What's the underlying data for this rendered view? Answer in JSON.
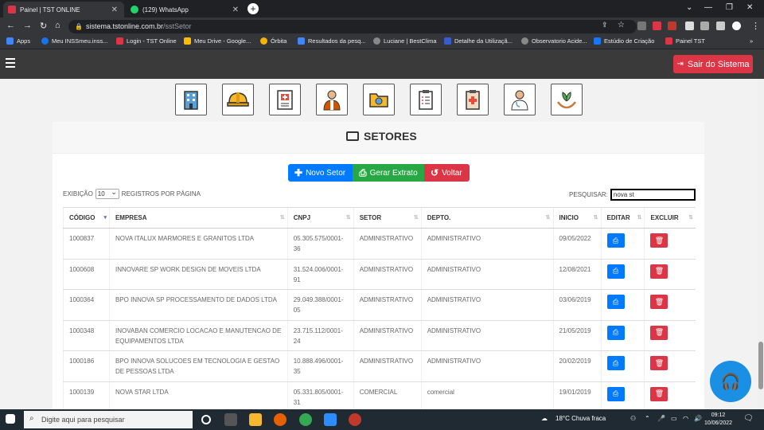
{
  "browser": {
    "tabs": [
      {
        "title": "Painel | TST ONLINE",
        "icon": "tst-favicon",
        "active": true
      },
      {
        "title": "(129) WhatsApp",
        "icon": "whatsapp-favicon",
        "active": false
      }
    ],
    "url_domain": "sistema.tstonline.com.br",
    "url_path": "/sstSetor",
    "bookmarks": [
      "Apps",
      "Meu INSSmeu.inss...",
      "Login - TST Online",
      "Meu Drive - Google...",
      "Órbita",
      "Resultados da pesq...",
      "Luciane | BestClima",
      "Detalhe da Utilizaçã...",
      "Observatorio Acide...",
      "Estúdio de Criação",
      "Painel TST"
    ],
    "bookmarks_more": "»"
  },
  "header": {
    "logout_label": "Sair do Sistema"
  },
  "modules": [
    "building-icon",
    "helmet-icon",
    "medical-record-icon",
    "worker-icon",
    "folder-icon",
    "clipboard-list-icon",
    "medical-clipboard-icon",
    "doctor-icon",
    "plant-hands-icon"
  ],
  "page": {
    "title": "SETORES",
    "btn_new": "Novo Setor",
    "btn_export": "Gerar Extrato",
    "btn_back": "Voltar",
    "show_label": "EXIBIÇÃO",
    "show_value": "10",
    "per_page_label": "REGISTROS POR PÁGINA",
    "search_label": "PESQUISAR:",
    "search_value": "nova st"
  },
  "table": {
    "headers": [
      "CÓDIGO",
      "EMPRESA",
      "CNPJ",
      "SETOR",
      "DEPTO.",
      "INICIO",
      "EDITAR",
      "EXCLUIR"
    ],
    "rows": [
      {
        "codigo": "1000837",
        "empresa": "NOVA ITALUX MARMORES E GRANITOS LTDA",
        "cnpj": "05.305.575/0001-36",
        "setor": "ADMINISTRATIVO",
        "depto": "ADMINISTRATIVO",
        "inicio": "09/05/2022"
      },
      {
        "codigo": "1000608",
        "empresa": "INNOVARE SP WORK DESIGN DE MOVEIS LTDA",
        "cnpj": "31.524.006/0001-91",
        "setor": "ADMINISTRATIVO",
        "depto": "ADMINISTRATIVO",
        "inicio": "12/08/2021"
      },
      {
        "codigo": "1000364",
        "empresa": "BPO INNOVA SP PROCESSAMENTO DE DADOS LTDA",
        "cnpj": "29.049.388/0001-05",
        "setor": "ADMINISTRATIVO",
        "depto": "ADMINISTRATIVO",
        "inicio": "03/06/2019"
      },
      {
        "codigo": "1000348",
        "empresa": "INOVABAN COMERCIO LOCACAO E MANUTENCAO DE EQUIPAMENTOS LTDA",
        "cnpj": "23.715.112/0001-24",
        "setor": "ADMINISTRATIVO",
        "depto": "ADMINISTRATIVO",
        "inicio": "21/05/2019"
      },
      {
        "codigo": "1000186",
        "empresa": "BPO INNOVA SOLUCOES EM TECNOLOGIA E GESTAO DE PESSOAS LTDA",
        "cnpj": "10.888.496/0001-35",
        "setor": "ADMINISTRATIVO",
        "depto": "ADMINISTRATIVO",
        "inicio": "20/02/2019"
      },
      {
        "codigo": "1000139",
        "empresa": "NOVA STAR LTDA",
        "cnpj": "05.331.805/0001-31",
        "setor": "COMERCIAL",
        "depto": "comercial",
        "inicio": "19/01/2019"
      }
    ]
  },
  "taskbar": {
    "search_placeholder": "Digite aqui para pesquisar",
    "weather": "18°C  Chuva fraca",
    "time": "09:12",
    "date": "10/06/2022"
  },
  "colors": {
    "primary": "#007bff",
    "success": "#28a745",
    "danger": "#dc3545",
    "header_bg": "#3a3a3a"
  }
}
